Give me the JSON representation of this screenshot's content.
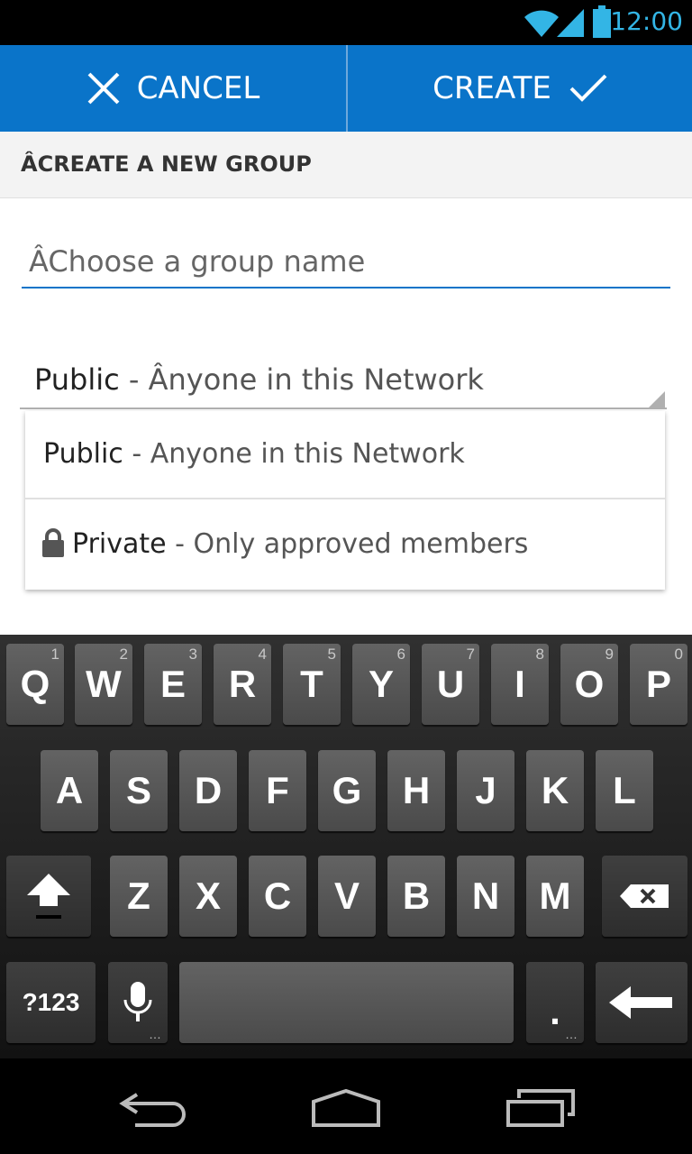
{
  "status_bar": {
    "time": "12:00",
    "icons": [
      "wifi-icon",
      "signal-icon",
      "battery-icon"
    ],
    "accent_color": "#33b5e5"
  },
  "action_bar": {
    "cancel_label": "CANCEL",
    "create_label": "CREATE",
    "background_color": "#0a74c9"
  },
  "section": {
    "title": "ÂCREATE A NEW GROUP"
  },
  "group_name_input": {
    "placeholder": "ÂChoose a group name",
    "value": ""
  },
  "privacy_spinner": {
    "selected_main": "Public",
    "selected_sep": " - ",
    "selected_desc": "Ânyone in this Network"
  },
  "privacy_options": [
    {
      "main": "Public",
      "sep": " - ",
      "desc": "Anyone in this Network",
      "icon": null
    },
    {
      "main": "Private",
      "sep": " - ",
      "desc": "Only approved members",
      "icon": "lock-icon"
    }
  ],
  "keyboard": {
    "row1": [
      {
        "label": "Q",
        "hint": "1"
      },
      {
        "label": "W",
        "hint": "2"
      },
      {
        "label": "E",
        "hint": "3"
      },
      {
        "label": "R",
        "hint": "4"
      },
      {
        "label": "T",
        "hint": "5"
      },
      {
        "label": "Y",
        "hint": "6"
      },
      {
        "label": "U",
        "hint": "7"
      },
      {
        "label": "I",
        "hint": "8"
      },
      {
        "label": "O",
        "hint": "9"
      },
      {
        "label": "P",
        "hint": "0"
      }
    ],
    "row2": [
      "A",
      "S",
      "D",
      "F",
      "G",
      "H",
      "J",
      "K",
      "L"
    ],
    "row3": [
      "Z",
      "X",
      "C",
      "V",
      "B",
      "N",
      "M"
    ],
    "symbols_label": "?123",
    "period_label": ".",
    "more_dots": "…",
    "special_keys": [
      "shift-icon",
      "backspace-icon",
      "microphone-icon",
      "enter-icon"
    ]
  },
  "nav_bar": {
    "buttons": [
      "back-icon",
      "home-icon",
      "recent-apps-icon"
    ]
  }
}
